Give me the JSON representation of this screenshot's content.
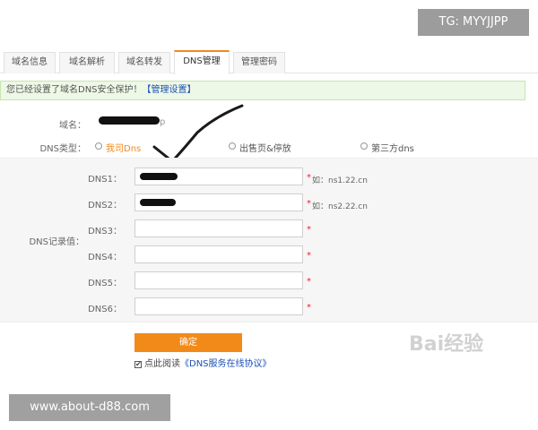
{
  "watermarks": {
    "tg": "TG: MYYJJPP",
    "site": "www.about-d88.com",
    "baidu": "Bai经验"
  },
  "tabs": [
    {
      "label": "域名信息"
    },
    {
      "label": "域名解析"
    },
    {
      "label": "域名转发"
    },
    {
      "label": "DNS管理",
      "active": true
    },
    {
      "label": "管理密码"
    }
  ],
  "notice": {
    "text": "您已经设置了域名DNS安全保护！",
    "link": "【管理设置】"
  },
  "domain": {
    "label": "域名：",
    "value_suffix": "p"
  },
  "dns_type": {
    "label": "DNS类型：",
    "options": [
      {
        "label": "我司Dns",
        "selected": true
      },
      {
        "label": "出售页&停放"
      },
      {
        "label": "第三方dns"
      }
    ]
  },
  "records": {
    "label": "DNS记录值：",
    "rows": [
      {
        "label": "DNS1：",
        "hint": "如：ns1.22.cn"
      },
      {
        "label": "DNS2：",
        "hint": "如：ns2.22.cn"
      },
      {
        "label": "DNS3：",
        "hint": ""
      },
      {
        "label": "DNS4：",
        "hint": ""
      },
      {
        "label": "DNS5：",
        "hint": ""
      },
      {
        "label": "DNS6：",
        "hint": ""
      }
    ],
    "required_mark": "*"
  },
  "confirm_label": "确定",
  "agreement": {
    "checkbox": "✔",
    "text": "点此阅读",
    "link": "《DNS服务在线协议》"
  }
}
